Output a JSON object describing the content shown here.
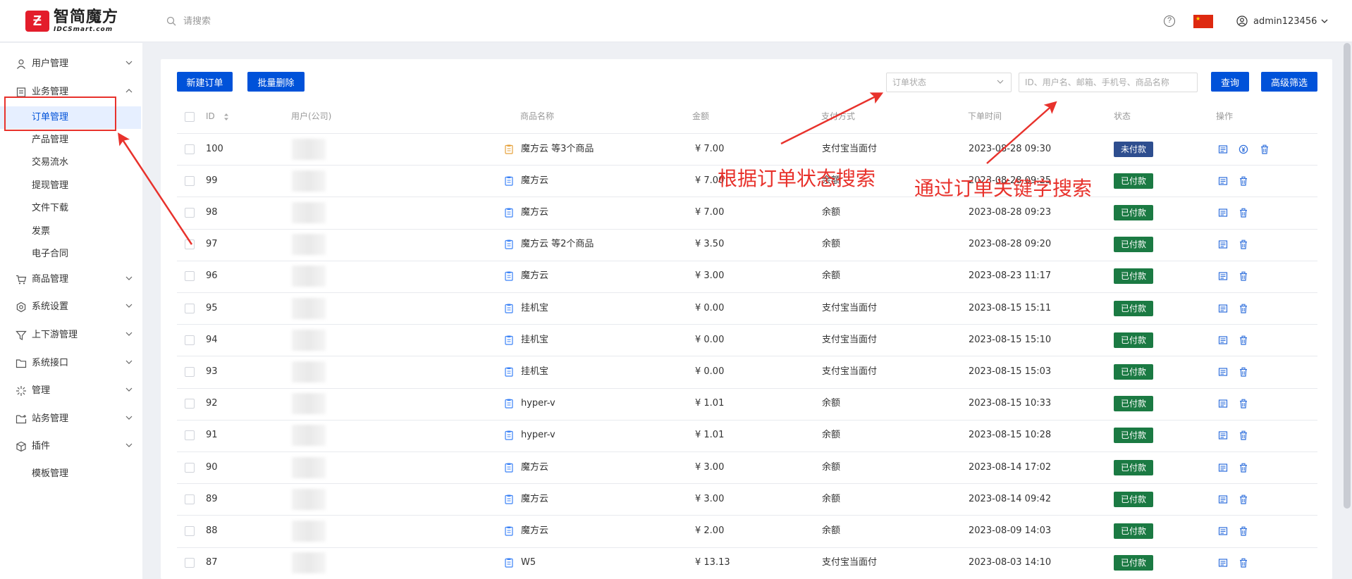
{
  "header": {
    "logo_cn": "智简魔方",
    "logo_en": "IDCSmart.com",
    "search_placeholder": "请搜索",
    "help_label": "?",
    "username": "admin123456"
  },
  "sidebar": {
    "items": [
      {
        "label": "用户管理",
        "icon": "user-icon"
      },
      {
        "label": "业务管理",
        "icon": "document-icon",
        "expanded": true
      },
      {
        "label": "商品管理",
        "icon": "cart-icon"
      },
      {
        "label": "系统设置",
        "icon": "settings-icon"
      },
      {
        "label": "上下游管理",
        "icon": "filter-icon"
      },
      {
        "label": "系统接口",
        "icon": "folder-icon"
      },
      {
        "label": "管理",
        "icon": "sparkle-icon"
      },
      {
        "label": "站务管理",
        "icon": "folder-plus-icon"
      },
      {
        "label": "插件",
        "icon": "cube-icon"
      }
    ],
    "sub_items": [
      "订单管理",
      "产品管理",
      "交易流水",
      "提现管理",
      "文件下载",
      "发票",
      "电子合同"
    ],
    "extra_item": "模板管理"
  },
  "toolbar": {
    "new_order": "新建订单",
    "batch_delete": "批量删除",
    "status_placeholder": "订单状态",
    "keyword_placeholder": "ID、用户名、邮箱、手机号、商品名称",
    "query": "查询",
    "advanced": "高级筛选"
  },
  "table": {
    "headers": [
      "ID",
      "用户(公司)",
      "商品名称",
      "金额",
      "支付方式",
      "下单时间",
      "状态",
      "操作"
    ],
    "rows": [
      {
        "id": "100",
        "product": "魔方云 等3个商品",
        "amount": "¥ 7.00",
        "pay": "支付宝当面付",
        "time": "2023-08-28 09:30",
        "status": "未付款",
        "paid": false,
        "multi": true
      },
      {
        "id": "99",
        "product": "魔方云",
        "amount": "¥ 7.00",
        "pay": "余额",
        "time": "2023-08-28 09:25",
        "status": "已付款",
        "paid": true,
        "multi": false
      },
      {
        "id": "98",
        "product": "魔方云",
        "amount": "¥ 7.00",
        "pay": "余额",
        "time": "2023-08-28 09:23",
        "status": "已付款",
        "paid": true,
        "multi": false
      },
      {
        "id": "97",
        "product": "魔方云 等2个商品",
        "amount": "¥ 3.50",
        "pay": "余额",
        "time": "2023-08-28 09:20",
        "status": "已付款",
        "paid": true,
        "multi": false
      },
      {
        "id": "96",
        "product": "魔方云",
        "amount": "¥ 3.00",
        "pay": "余额",
        "time": "2023-08-23 11:17",
        "status": "已付款",
        "paid": true,
        "multi": false
      },
      {
        "id": "95",
        "product": "挂机宝",
        "amount": "¥ 0.00",
        "pay": "支付宝当面付",
        "time": "2023-08-15 15:11",
        "status": "已付款",
        "paid": true,
        "multi": false
      },
      {
        "id": "94",
        "product": "挂机宝",
        "amount": "¥ 0.00",
        "pay": "支付宝当面付",
        "time": "2023-08-15 15:10",
        "status": "已付款",
        "paid": true,
        "multi": false
      },
      {
        "id": "93",
        "product": "挂机宝",
        "amount": "¥ 0.00",
        "pay": "支付宝当面付",
        "time": "2023-08-15 15:03",
        "status": "已付款",
        "paid": true,
        "multi": false
      },
      {
        "id": "92",
        "product": "hyper-v",
        "amount": "¥ 1.01",
        "pay": "余额",
        "time": "2023-08-15 10:33",
        "status": "已付款",
        "paid": true,
        "multi": false
      },
      {
        "id": "91",
        "product": "hyper-v",
        "amount": "¥ 1.01",
        "pay": "余额",
        "time": "2023-08-15 10:28",
        "status": "已付款",
        "paid": true,
        "multi": false
      },
      {
        "id": "90",
        "product": "魔方云",
        "amount": "¥ 3.00",
        "pay": "余额",
        "time": "2023-08-14 17:02",
        "status": "已付款",
        "paid": true,
        "multi": false
      },
      {
        "id": "89",
        "product": "魔方云",
        "amount": "¥ 3.00",
        "pay": "余额",
        "time": "2023-08-14 09:42",
        "status": "已付款",
        "paid": true,
        "multi": false
      },
      {
        "id": "88",
        "product": "魔方云",
        "amount": "¥ 2.00",
        "pay": "余额",
        "time": "2023-08-09 14:03",
        "status": "已付款",
        "paid": true,
        "multi": false
      },
      {
        "id": "87",
        "product": "W5",
        "amount": "¥ 13.13",
        "pay": "支付宝当面付",
        "time": "2023-08-03 14:10",
        "status": "已付款",
        "paid": true,
        "multi": false
      }
    ]
  },
  "annotations": {
    "status_search": "根据订单状态搜索",
    "keyword_search": "通过订单关键字搜索"
  },
  "colors": {
    "primary": "#0052d9",
    "paid": "#1b7a43",
    "unpaid": "#2e4e8f",
    "annotation": "#e8322c"
  }
}
